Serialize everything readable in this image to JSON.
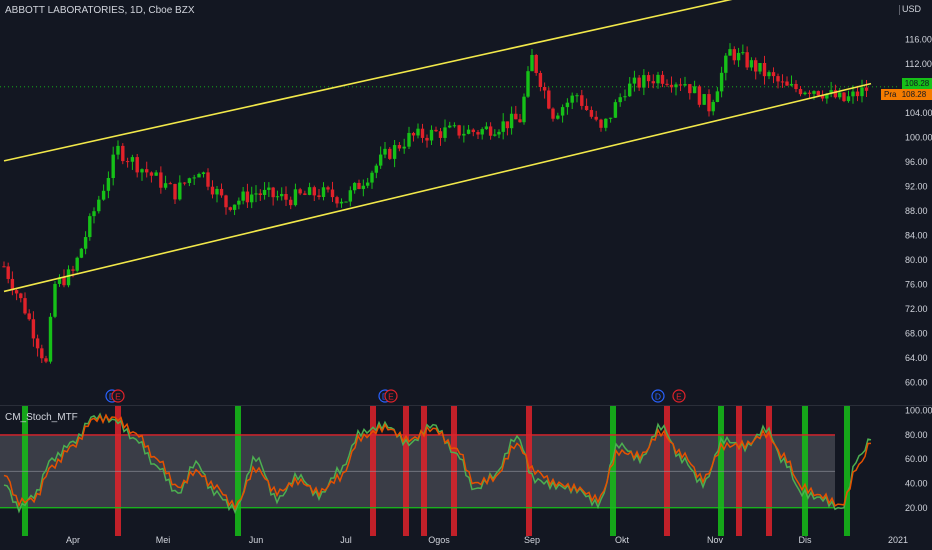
{
  "header": {
    "symbol_title": "ABBOTT LABORATORIES, 1D, Cboe BZX",
    "currency": "USD"
  },
  "price_tags": {
    "last_price": "108.28",
    "pra_label": "Pra",
    "pra_price": "108.28"
  },
  "indicator": {
    "name": "CM_Stoch_MTF"
  },
  "colors": {
    "background": "#131722",
    "bull": "#16c018",
    "bear": "#e0222a",
    "channel": "#f2e84a",
    "stoch_k": "#4caf50",
    "stoch_d": "#e65100",
    "band_fill": "#5b5d66",
    "band_upper": "#e0222a",
    "band_lower": "#16c018",
    "dividend_badge": "#2962ff",
    "earnings_badge": "#e0222a"
  },
  "chart_data": [
    {
      "type": "candlestick",
      "title": "ABBOTT LABORATORIES, 1D, Cboe BZX",
      "ylim": [
        58,
        120
      ],
      "y_ticks": [
        60,
        64,
        68,
        72,
        76,
        80,
        84,
        88,
        92,
        96,
        100,
        104,
        108,
        112,
        116
      ],
      "x_tick_labels": [
        "Apr",
        "Mei",
        "Jun",
        "Jul",
        "Ogos",
        "Sep",
        "Okt",
        "Nov",
        "Dis",
        "2021"
      ],
      "grid": false,
      "last_price": 108.28,
      "channel_lines": [
        {
          "from": {
            "date": "2020-03-09",
            "price": 96.2
          },
          "to": {
            "date": "2020-12-23",
            "price": 127.6
          }
        },
        {
          "from": {
            "date": "2020-03-09",
            "price": 74.9
          },
          "to": {
            "date": "2020-12-23",
            "price": 108.8
          }
        }
      ],
      "events": [
        {
          "label": "D",
          "kind": "dividend",
          "date": "2020-04-14"
        },
        {
          "label": "E",
          "kind": "earnings",
          "date": "2020-04-16"
        },
        {
          "label": "D",
          "kind": "dividend",
          "date": "2020-07-14"
        },
        {
          "label": "E",
          "kind": "earnings",
          "date": "2020-07-16"
        },
        {
          "label": "D",
          "kind": "dividend",
          "date": "2020-10-13"
        },
        {
          "label": "E",
          "kind": "earnings",
          "date": "2020-10-20"
        }
      ],
      "close_path": [
        {
          "date": "2020-03-09",
          "close": 79
        },
        {
          "date": "2020-03-16",
          "close": 72
        },
        {
          "date": "2020-03-23",
          "close": 63
        },
        {
          "date": "2020-03-26",
          "close": 76
        },
        {
          "date": "2020-04-01",
          "close": 78
        },
        {
          "date": "2020-04-08",
          "close": 88
        },
        {
          "date": "2020-04-16",
          "close": 98
        },
        {
          "date": "2020-04-24",
          "close": 95
        },
        {
          "date": "2020-05-05",
          "close": 91
        },
        {
          "date": "2020-05-13",
          "close": 95
        },
        {
          "date": "2020-05-22",
          "close": 89
        },
        {
          "date": "2020-06-01",
          "close": 91
        },
        {
          "date": "2020-06-11",
          "close": 90
        },
        {
          "date": "2020-06-22",
          "close": 91
        },
        {
          "date": "2020-07-01",
          "close": 90
        },
        {
          "date": "2020-07-14",
          "close": 97
        },
        {
          "date": "2020-07-22",
          "close": 100
        },
        {
          "date": "2020-08-03",
          "close": 101
        },
        {
          "date": "2020-08-14",
          "close": 101
        },
        {
          "date": "2020-08-28",
          "close": 103
        },
        {
          "date": "2020-09-01",
          "close": 113
        },
        {
          "date": "2020-09-08",
          "close": 104
        },
        {
          "date": "2020-09-16",
          "close": 107
        },
        {
          "date": "2020-09-24",
          "close": 101
        },
        {
          "date": "2020-10-02",
          "close": 108
        },
        {
          "date": "2020-10-13",
          "close": 110
        },
        {
          "date": "2020-10-22",
          "close": 109
        },
        {
          "date": "2020-10-30",
          "close": 105
        },
        {
          "date": "2020-11-06",
          "close": 114
        },
        {
          "date": "2020-11-16",
          "close": 111
        },
        {
          "date": "2020-11-25",
          "close": 108
        },
        {
          "date": "2020-12-04",
          "close": 108
        },
        {
          "date": "2020-12-14",
          "close": 106
        },
        {
          "date": "2020-12-23",
          "close": 108.28
        }
      ]
    },
    {
      "type": "line",
      "title": "CM_Stoch_MTF",
      "ylim": [
        5,
        103
      ],
      "y_ticks": [
        20,
        40,
        60,
        80,
        100
      ],
      "bands": {
        "upper": 80,
        "middle": 50,
        "lower": 20
      },
      "series": [
        {
          "values": [
            {
              "date": "2020-03-09",
              "value": 40
            },
            {
              "date": "2020-03-14",
              "value": 20
            },
            {
              "date": "2020-03-19",
              "value": 30
            },
            {
              "date": "2020-03-25",
              "value": 60
            },
            {
              "date": "2020-04-01",
              "value": 74
            },
            {
              "date": "2020-04-08",
              "value": 95
            },
            {
              "date": "2020-04-15",
              "value": 92
            },
            {
              "date": "2020-04-22",
              "value": 76
            },
            {
              "date": "2020-04-29",
              "value": 54
            },
            {
              "date": "2020-05-06",
              "value": 32
            },
            {
              "date": "2020-05-12",
              "value": 57
            },
            {
              "date": "2020-05-18",
              "value": 33
            },
            {
              "date": "2020-05-25",
              "value": 19
            },
            {
              "date": "2020-06-01",
              "value": 61
            },
            {
              "date": "2020-06-08",
              "value": 27
            },
            {
              "date": "2020-06-15",
              "value": 46
            },
            {
              "date": "2020-06-22",
              "value": 30
            },
            {
              "date": "2020-06-29",
              "value": 51
            },
            {
              "date": "2020-07-06",
              "value": 82
            },
            {
              "date": "2020-07-14",
              "value": 88
            },
            {
              "date": "2020-07-22",
              "value": 73
            },
            {
              "date": "2020-07-30",
              "value": 88
            },
            {
              "date": "2020-08-07",
              "value": 64
            },
            {
              "date": "2020-08-13",
              "value": 35
            },
            {
              "date": "2020-08-19",
              "value": 46
            },
            {
              "date": "2020-08-27",
              "value": 78
            },
            {
              "date": "2020-09-02",
              "value": 43
            },
            {
              "date": "2020-09-09",
              "value": 38
            },
            {
              "date": "2020-09-16",
              "value": 35
            },
            {
              "date": "2020-09-23",
              "value": 23
            },
            {
              "date": "2020-09-30",
              "value": 72
            },
            {
              "date": "2020-10-07",
              "value": 60
            },
            {
              "date": "2020-10-14",
              "value": 87
            },
            {
              "date": "2020-10-21",
              "value": 60
            },
            {
              "date": "2020-10-28",
              "value": 40
            },
            {
              "date": "2020-11-04",
              "value": 76
            },
            {
              "date": "2020-11-11",
              "value": 70
            },
            {
              "date": "2020-11-18",
              "value": 85
            },
            {
              "date": "2020-11-24",
              "value": 58
            },
            {
              "date": "2020-11-30",
              "value": 32
            },
            {
              "date": "2020-12-06",
              "value": 28
            },
            {
              "date": "2020-12-13",
              "value": 19
            },
            {
              "date": "2020-12-19",
              "value": 62
            },
            {
              "date": "2020-12-23",
              "value": 76
            }
          ]
        },
        {
          "values": [
            {
              "date": "2020-03-09",
              "value": 48
            },
            {
              "date": "2020-03-14",
              "value": 25
            },
            {
              "date": "2020-03-19",
              "value": 27
            },
            {
              "date": "2020-03-25",
              "value": 54
            },
            {
              "date": "2020-04-01",
              "value": 71
            },
            {
              "date": "2020-04-08",
              "value": 93
            },
            {
              "date": "2020-04-15",
              "value": 94
            },
            {
              "date": "2020-04-22",
              "value": 81
            },
            {
              "date": "2020-04-29",
              "value": 60
            },
            {
              "date": "2020-05-06",
              "value": 37
            },
            {
              "date": "2020-05-12",
              "value": 50
            },
            {
              "date": "2020-05-18",
              "value": 38
            },
            {
              "date": "2020-05-25",
              "value": 22
            },
            {
              "date": "2020-06-01",
              "value": 52
            },
            {
              "date": "2020-06-08",
              "value": 33
            },
            {
              "date": "2020-06-15",
              "value": 42
            },
            {
              "date": "2020-06-22",
              "value": 33
            },
            {
              "date": "2020-06-29",
              "value": 45
            },
            {
              "date": "2020-07-06",
              "value": 78
            },
            {
              "date": "2020-07-14",
              "value": 86
            },
            {
              "date": "2020-07-22",
              "value": 76
            },
            {
              "date": "2020-07-30",
              "value": 85
            },
            {
              "date": "2020-08-07",
              "value": 68
            },
            {
              "date": "2020-08-13",
              "value": 40
            },
            {
              "date": "2020-08-19",
              "value": 44
            },
            {
              "date": "2020-08-27",
              "value": 72
            },
            {
              "date": "2020-09-02",
              "value": 50
            },
            {
              "date": "2020-09-09",
              "value": 40
            },
            {
              "date": "2020-09-16",
              "value": 36
            },
            {
              "date": "2020-09-23",
              "value": 27
            },
            {
              "date": "2020-09-30",
              "value": 66
            },
            {
              "date": "2020-10-07",
              "value": 63
            },
            {
              "date": "2020-10-14",
              "value": 82
            },
            {
              "date": "2020-10-21",
              "value": 64
            },
            {
              "date": "2020-10-28",
              "value": 44
            },
            {
              "date": "2020-11-04",
              "value": 71
            },
            {
              "date": "2020-11-11",
              "value": 72
            },
            {
              "date": "2020-11-18",
              "value": 81
            },
            {
              "date": "2020-11-24",
              "value": 62
            },
            {
              "date": "2020-11-30",
              "value": 37
            },
            {
              "date": "2020-12-06",
              "value": 30
            },
            {
              "date": "2020-12-13",
              "value": 22
            },
            {
              "date": "2020-12-19",
              "value": 55
            },
            {
              "date": "2020-12-23",
              "value": 73
            }
          ]
        }
      ],
      "signal_bars": [
        {
          "date": "2020-03-16",
          "signal": "buy"
        },
        {
          "date": "2020-04-16",
          "signal": "sell"
        },
        {
          "date": "2020-05-26",
          "signal": "buy"
        },
        {
          "date": "2020-07-10",
          "signal": "sell"
        },
        {
          "date": "2020-07-21",
          "signal": "sell"
        },
        {
          "date": "2020-07-27",
          "signal": "sell"
        },
        {
          "date": "2020-08-06",
          "signal": "sell"
        },
        {
          "date": "2020-08-31",
          "signal": "sell"
        },
        {
          "date": "2020-09-28",
          "signal": "buy"
        },
        {
          "date": "2020-10-16",
          "signal": "sell"
        },
        {
          "date": "2020-11-03",
          "signal": "buy"
        },
        {
          "date": "2020-11-09",
          "signal": "sell"
        },
        {
          "date": "2020-11-19",
          "signal": "sell"
        },
        {
          "date": "2020-12-01",
          "signal": "buy"
        },
        {
          "date": "2020-12-15",
          "signal": "buy"
        }
      ]
    }
  ]
}
